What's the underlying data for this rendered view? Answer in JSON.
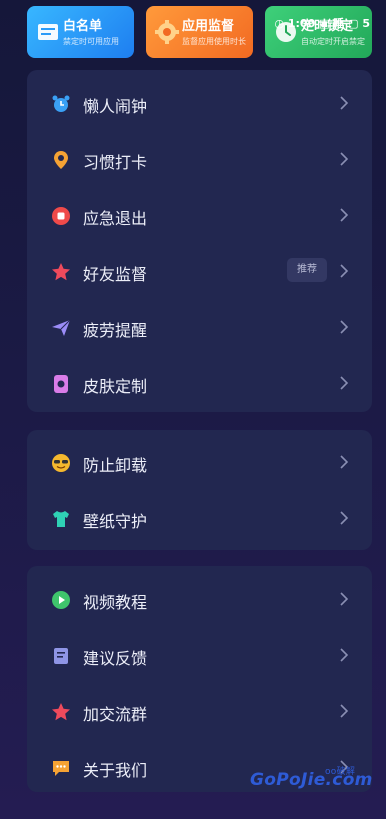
{
  "status_bar": {
    "text": "◷ 1:00 ▣ 睡 ▢ 5"
  },
  "top_cards": [
    {
      "title": "白名单",
      "subtitle": "禁定时可用应用",
      "color": "#2b9cf8",
      "icon": "list-icon"
    },
    {
      "title": "应用监督",
      "subtitle": "监督应用使用时长",
      "color": "#f5822e",
      "icon": "gear-icon"
    },
    {
      "title": "定时锁定",
      "subtitle": "自动定时开启禁定",
      "color": "#30bd6a",
      "icon": "timer-icon"
    }
  ],
  "menu_group_1": [
    {
      "label": "懒人闹钟",
      "icon": "alarm-clock-icon",
      "color": "#3aa0f5"
    },
    {
      "label": "习惯打卡",
      "icon": "location-pin-icon",
      "color": "#f5a234"
    },
    {
      "label": "应急退出",
      "icon": "stop-icon",
      "color": "#ef4a4a"
    },
    {
      "label": "好友监督",
      "icon": "star-icon",
      "color": "#ef4a5c",
      "badge": "推荐"
    },
    {
      "label": "疲劳提醒",
      "icon": "paper-plane-icon",
      "color": "#9b8cf7"
    },
    {
      "label": "皮肤定制",
      "icon": "skin-icon",
      "color": "#d97ce8"
    }
  ],
  "menu_group_2": [
    {
      "label": "防止卸载",
      "icon": "sunglasses-face-icon",
      "color": "#f5b82e"
    },
    {
      "label": "壁纸守护",
      "icon": "shirt-icon",
      "color": "#2fd1b5"
    }
  ],
  "menu_group_3": [
    {
      "label": "视频教程",
      "icon": "play-icon",
      "color": "#3fc46c"
    },
    {
      "label": "建议反馈",
      "icon": "edit-note-icon",
      "color": "#8f95e6"
    },
    {
      "label": "加交流群",
      "icon": "star-icon",
      "color": "#ef4a5c"
    },
    {
      "label": "关于我们",
      "icon": "chat-bubble-icon",
      "color": "#f5a234"
    }
  ],
  "watermark": {
    "text": "GoPoJie.com",
    "sub": "oo破解"
  }
}
